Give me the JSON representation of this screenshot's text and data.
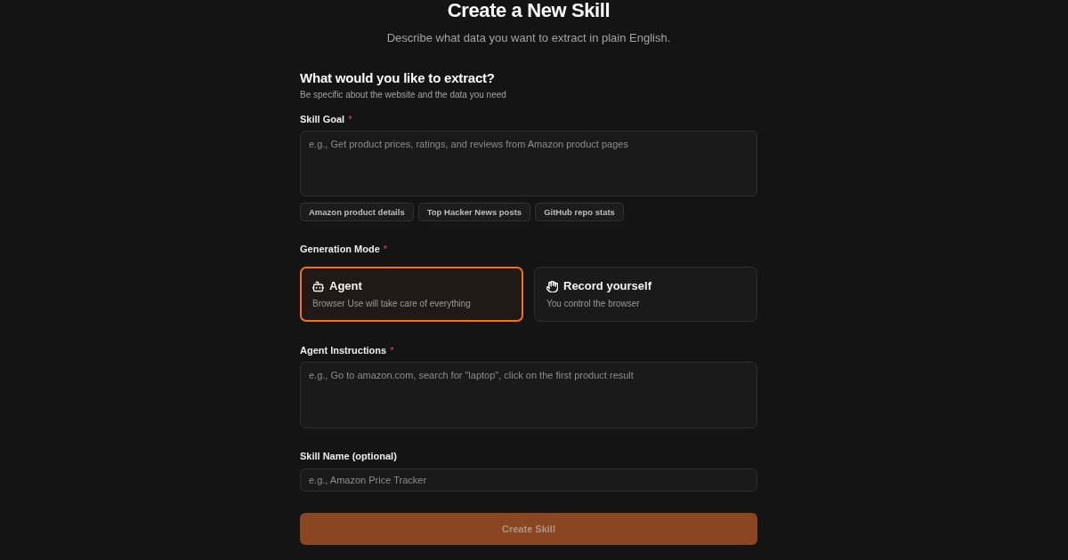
{
  "header": {
    "title": "Create a New Skill",
    "subtitle": "Describe what data you want to extract in plain English."
  },
  "section": {
    "heading": "What would you like to extract?",
    "description": "Be specific about the website and the data you need"
  },
  "skill_goal": {
    "label": "Skill Goal",
    "required_mark": "*",
    "placeholder": "e.g., Get product prices, ratings, and reviews from Amazon product pages",
    "suggestions": [
      "Amazon product details",
      "Top Hacker News posts",
      "GitHub repo stats"
    ]
  },
  "generation_mode": {
    "label": "Generation Mode",
    "required_mark": "*",
    "options": [
      {
        "kind": "agent",
        "title": "Agent",
        "description": "Browser Use will take care of everything",
        "selected": true
      },
      {
        "kind": "record",
        "title": "Record yourself",
        "description": "You control the browser",
        "selected": false
      }
    ]
  },
  "agent_instructions": {
    "label": "Agent Instructions",
    "required_mark": "*",
    "placeholder": "e.g., Go to amazon.com, search for \"laptop\", click on the first product result"
  },
  "skill_name": {
    "label": "Skill Name (optional)",
    "placeholder": "e.g., Amazon Price Tracker"
  },
  "submit": {
    "label": "Create Skill",
    "disabled": true
  }
}
